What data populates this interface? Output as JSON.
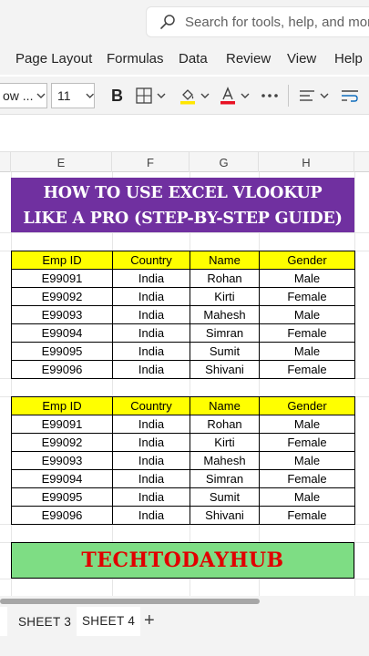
{
  "search": {
    "placeholder": "Search for tools, help, and more"
  },
  "menu": [
    "Page Layout",
    "Formulas",
    "Data",
    "Review",
    "View",
    "Help"
  ],
  "toolbar": {
    "font_name": "ow ...",
    "font_size": "11",
    "bold_label": "B"
  },
  "columns": [
    "E",
    "F",
    "G",
    "H"
  ],
  "banner": {
    "line1": "HOW TO USE EXCEL VLOOKUP",
    "line2": "LIKE A PRO (STEP-BY-STEP GUIDE)"
  },
  "table1": {
    "headers": [
      "Emp ID",
      "Country",
      "Name",
      "Gender"
    ],
    "rows": [
      [
        "E99091",
        "India",
        "Rohan",
        "Male"
      ],
      [
        "E99092",
        "India",
        "Kirti",
        "Female"
      ],
      [
        "E99093",
        "India",
        "Mahesh",
        "Male"
      ],
      [
        "E99094",
        "India",
        "Simran",
        "Female"
      ],
      [
        "E99095",
        "India",
        "Sumit",
        "Male"
      ],
      [
        "E99096",
        "India",
        "Shivani",
        "Female"
      ]
    ]
  },
  "table2": {
    "headers": [
      "Emp ID",
      "Country",
      "Name",
      "Gender"
    ],
    "rows": [
      [
        "E99091",
        "India",
        "Rohan",
        "Male"
      ],
      [
        "E99092",
        "India",
        "Kirti",
        "Female"
      ],
      [
        "E99093",
        "India",
        "Mahesh",
        "Male"
      ],
      [
        "E99094",
        "India",
        "Simran",
        "Female"
      ],
      [
        "E99095",
        "India",
        "Sumit",
        "Male"
      ],
      [
        "E99096",
        "India",
        "Shivani",
        "Female"
      ]
    ]
  },
  "footer_banner": "TECHTODAYHUB",
  "sheets": [
    "SHEET 3",
    "SHEET 4"
  ],
  "colors": {
    "banner_bg": "#7030a0",
    "header_bg": "#ffff00",
    "footer_bg": "#7edd84",
    "footer_text": "#e10000",
    "font_color_bar": "#e81123",
    "fill_color_bar": "#ffe600"
  }
}
